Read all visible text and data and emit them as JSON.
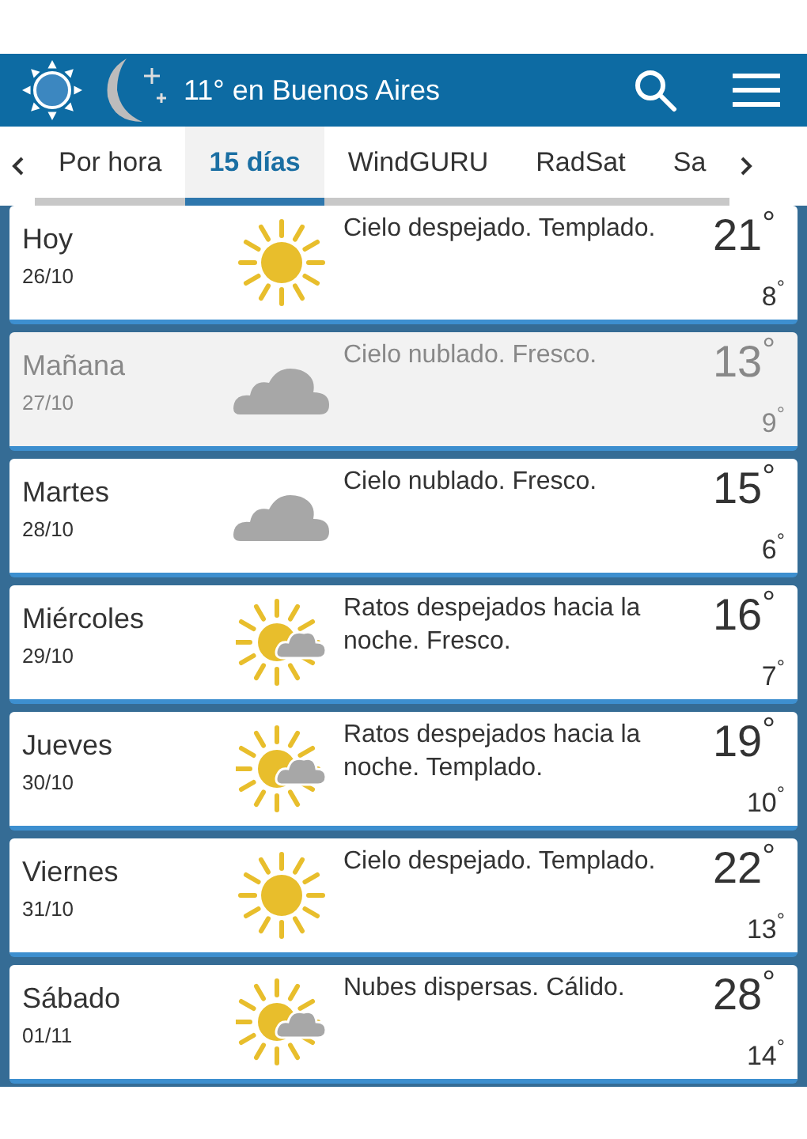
{
  "header": {
    "title": "11° en Buenos Aires"
  },
  "tabs": [
    {
      "label": "Por hora",
      "selected": false
    },
    {
      "label": "15 días",
      "selected": true
    },
    {
      "label": "WindGURU",
      "selected": false
    },
    {
      "label": "RadSat",
      "selected": false
    },
    {
      "label": "Sa",
      "selected": false
    }
  ],
  "days": [
    {
      "day": "Hoy",
      "date": "26/10",
      "kind": "sun",
      "summary": "Cielo despejado. Templado.",
      "high": "21$^{°}$",
      "low": "8$^{°}$",
      "selected": false
    },
    {
      "day": "Mañana",
      "date": "27/10",
      "kind": "cloud",
      "summary": "Cielo nublado. Fresco.",
      "high": "13$^{°}$",
      "low": "9$^{°}$",
      "selected": true
    },
    {
      "day": "Martes",
      "date": "28/10",
      "kind": "cloud",
      "summary": "Cielo nublado. Fresco.",
      "high": "15$^{°}$",
      "low": "6$^{°}$",
      "selected": false
    },
    {
      "day": "Miércoles",
      "date": "29/10",
      "kind": "sun-cloud",
      "summary": "Ratos despejados hacia la noche. Fresco.",
      "high": "16$^{°}$",
      "low": "7$^{°}$",
      "selected": false
    },
    {
      "day": "Jueves",
      "date": "30/10",
      "kind": "sun-cloud",
      "summary": "Ratos despejados hacia la noche. Templado.",
      "high": "19$^{°}$",
      "low": "10$^{°}$",
      "selected": false
    },
    {
      "day": "Viernes",
      "date": "31/10",
      "kind": "sun",
      "summary": "Cielo despejado. Templado.",
      "high": "22$^{°}$",
      "low": "13$^{°}$",
      "selected": false
    },
    {
      "day": "Sábado",
      "date": "01/11",
      "kind": "sun-cloud",
      "summary": "Nubes dispersas. Cálido.",
      "high": "28$^{°}$",
      "low": "14$^{°}$",
      "selected": false
    }
  ]
}
